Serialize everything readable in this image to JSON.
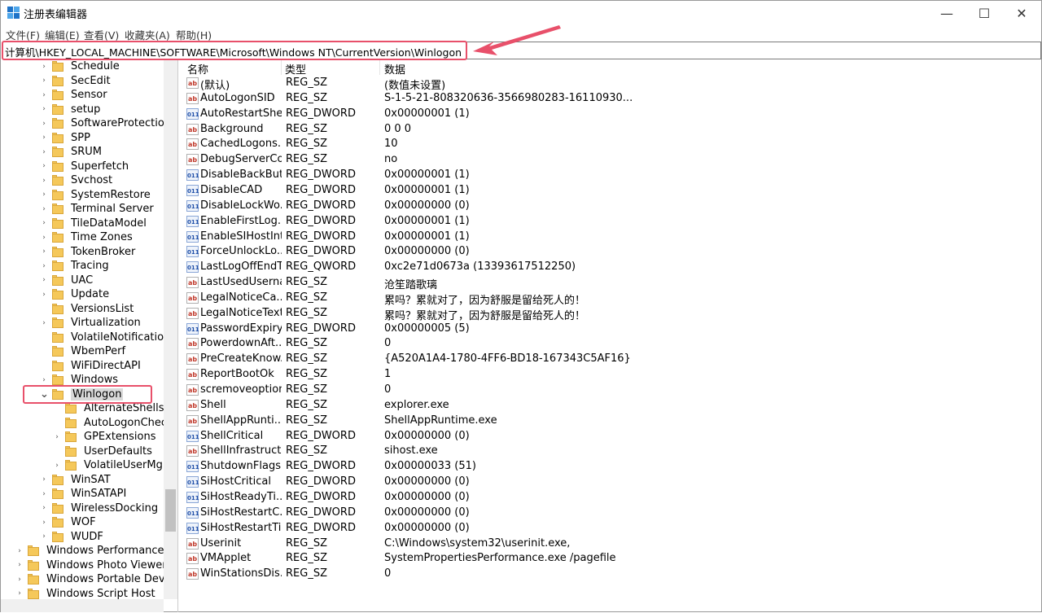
{
  "window": {
    "title": "注册表编辑器",
    "buttons": {
      "minimize": "—",
      "maximize": "☐",
      "close": "✕"
    }
  },
  "menu": [
    "文件(F)",
    "编辑(E)",
    "查看(V)",
    "收藏夹(A)",
    "帮助(H)"
  ],
  "address": "计算机\\HKEY_LOCAL_MACHINE\\SOFTWARE\\Microsoft\\Windows NT\\CurrentVersion\\Winlogon",
  "tree": [
    {
      "label": "Schedule",
      "expander": "›",
      "level": 1
    },
    {
      "label": "SecEdit",
      "expander": "›",
      "level": 1
    },
    {
      "label": "Sensor",
      "expander": "›",
      "level": 1
    },
    {
      "label": "setup",
      "expander": "›",
      "level": 1
    },
    {
      "label": "SoftwareProtectionPl",
      "expander": "›",
      "level": 1
    },
    {
      "label": "SPP",
      "expander": "›",
      "level": 1
    },
    {
      "label": "SRUM",
      "expander": "›",
      "level": 1
    },
    {
      "label": "Superfetch",
      "expander": "›",
      "level": 1
    },
    {
      "label": "Svchost",
      "expander": "›",
      "level": 1
    },
    {
      "label": "SystemRestore",
      "expander": "›",
      "level": 1
    },
    {
      "label": "Terminal Server",
      "expander": "›",
      "level": 1
    },
    {
      "label": "TileDataModel",
      "expander": "›",
      "level": 1
    },
    {
      "label": "Time Zones",
      "expander": "›",
      "level": 1
    },
    {
      "label": "TokenBroker",
      "expander": "›",
      "level": 1
    },
    {
      "label": "Tracing",
      "expander": "›",
      "level": 1
    },
    {
      "label": "UAC",
      "expander": "›",
      "level": 1
    },
    {
      "label": "Update",
      "expander": "›",
      "level": 1
    },
    {
      "label": "VersionsList",
      "expander": "",
      "level": 1
    },
    {
      "label": "Virtualization",
      "expander": "›",
      "level": 1
    },
    {
      "label": "VolatileNotifications",
      "expander": "",
      "level": 1
    },
    {
      "label": "WbemPerf",
      "expander": "",
      "level": 1
    },
    {
      "label": "WiFiDirectAPI",
      "expander": "",
      "level": 1
    },
    {
      "label": "Windows",
      "expander": "›",
      "level": 1
    },
    {
      "label": "Winlogon",
      "expander": "⌄",
      "level": 1,
      "selected": true
    },
    {
      "label": "AlternateShells",
      "expander": "",
      "level": 2
    },
    {
      "label": "AutoLogonChecked",
      "expander": "",
      "level": 2
    },
    {
      "label": "GPExtensions",
      "expander": "›",
      "level": 2
    },
    {
      "label": "UserDefaults",
      "expander": "",
      "level": 2
    },
    {
      "label": "VolatileUserMgrKey",
      "expander": "›",
      "level": 2
    },
    {
      "label": "WinSAT",
      "expander": "›",
      "level": 1
    },
    {
      "label": "WinSATAPI",
      "expander": "›",
      "level": 1
    },
    {
      "label": "WirelessDocking",
      "expander": "›",
      "level": 1
    },
    {
      "label": "WOF",
      "expander": "›",
      "level": 1
    },
    {
      "label": "WUDF",
      "expander": "›",
      "level": 1
    },
    {
      "label": "Windows Performance Toolkit",
      "expander": "›",
      "level": 0
    },
    {
      "label": "Windows Photo Viewer",
      "expander": "›",
      "level": 0
    },
    {
      "label": "Windows Portable Devices",
      "expander": "›",
      "level": 0
    },
    {
      "label": "Windows Script Host",
      "expander": "›",
      "level": 0
    }
  ],
  "list": {
    "headers": {
      "name": "名称",
      "type": "类型",
      "data": "数据"
    },
    "rows": [
      {
        "icon": "ab",
        "name": "(默认)",
        "type": "REG_SZ",
        "data": "(数值未设置)"
      },
      {
        "icon": "ab",
        "name": "AutoLogonSID",
        "type": "REG_SZ",
        "data": "S-1-5-21-808320636-3566980283-16110930..."
      },
      {
        "icon": "bin",
        "name": "AutoRestartShell",
        "type": "REG_DWORD",
        "data": "0x00000001 (1)"
      },
      {
        "icon": "ab",
        "name": "Background",
        "type": "REG_SZ",
        "data": "0 0 0"
      },
      {
        "icon": "ab",
        "name": "CachedLogons...",
        "type": "REG_SZ",
        "data": "10"
      },
      {
        "icon": "ab",
        "name": "DebugServerCo...",
        "type": "REG_SZ",
        "data": "no"
      },
      {
        "icon": "bin",
        "name": "DisableBackBut...",
        "type": "REG_DWORD",
        "data": "0x00000001 (1)"
      },
      {
        "icon": "bin",
        "name": "DisableCAD",
        "type": "REG_DWORD",
        "data": "0x00000001 (1)"
      },
      {
        "icon": "bin",
        "name": "DisableLockWo...",
        "type": "REG_DWORD",
        "data": "0x00000000 (0)"
      },
      {
        "icon": "bin",
        "name": "EnableFirstLog...",
        "type": "REG_DWORD",
        "data": "0x00000001 (1)"
      },
      {
        "icon": "bin",
        "name": "EnableSIHostInt...",
        "type": "REG_DWORD",
        "data": "0x00000001 (1)"
      },
      {
        "icon": "bin",
        "name": "ForceUnlockLo...",
        "type": "REG_DWORD",
        "data": "0x00000000 (0)"
      },
      {
        "icon": "bin",
        "name": "LastLogOffEndT...",
        "type": "REG_QWORD",
        "data": "0xc2e71d0673a (13393617512250)"
      },
      {
        "icon": "ab",
        "name": "LastUsedUserna...",
        "type": "REG_SZ",
        "data": "沧笙踏歌璃"
      },
      {
        "icon": "ab",
        "name": "LegalNoticeCa...",
        "type": "REG_SZ",
        "data": "累吗？累就对了，因为舒服是留给死人的！"
      },
      {
        "icon": "ab",
        "name": "LegalNoticeText",
        "type": "REG_SZ",
        "data": "累吗？累就对了，因为舒服是留给死人的！"
      },
      {
        "icon": "bin",
        "name": "PasswordExpiry...",
        "type": "REG_DWORD",
        "data": "0x00000005 (5)"
      },
      {
        "icon": "ab",
        "name": "PowerdownAft...",
        "type": "REG_SZ",
        "data": "0"
      },
      {
        "icon": "ab",
        "name": "PreCreateKnow...",
        "type": "REG_SZ",
        "data": "{A520A1A4-1780-4FF6-BD18-167343C5AF16}"
      },
      {
        "icon": "ab",
        "name": "ReportBootOk",
        "type": "REG_SZ",
        "data": "1"
      },
      {
        "icon": "ab",
        "name": "scremoveoption",
        "type": "REG_SZ",
        "data": "0"
      },
      {
        "icon": "ab",
        "name": "Shell",
        "type": "REG_SZ",
        "data": "explorer.exe"
      },
      {
        "icon": "ab",
        "name": "ShellAppRunti...",
        "type": "REG_SZ",
        "data": "ShellAppRuntime.exe"
      },
      {
        "icon": "bin",
        "name": "ShellCritical",
        "type": "REG_DWORD",
        "data": "0x00000000 (0)"
      },
      {
        "icon": "ab",
        "name": "ShellInfrastruct...",
        "type": "REG_SZ",
        "data": "sihost.exe"
      },
      {
        "icon": "bin",
        "name": "ShutdownFlags",
        "type": "REG_DWORD",
        "data": "0x00000033 (51)"
      },
      {
        "icon": "bin",
        "name": "SiHostCritical",
        "type": "REG_DWORD",
        "data": "0x00000000 (0)"
      },
      {
        "icon": "bin",
        "name": "SiHostReadyTi...",
        "type": "REG_DWORD",
        "data": "0x00000000 (0)"
      },
      {
        "icon": "bin",
        "name": "SiHostRestartC...",
        "type": "REG_DWORD",
        "data": "0x00000000 (0)"
      },
      {
        "icon": "bin",
        "name": "SiHostRestartTi...",
        "type": "REG_DWORD",
        "data": "0x00000000 (0)"
      },
      {
        "icon": "ab",
        "name": "Userinit",
        "type": "REG_SZ",
        "data": "C:\\Windows\\system32\\userinit.exe,"
      },
      {
        "icon": "ab",
        "name": "VMApplet",
        "type": "REG_SZ",
        "data": "SystemPropertiesPerformance.exe /pagefile"
      },
      {
        "icon": "ab",
        "name": "WinStationsDis...",
        "type": "REG_SZ",
        "data": "0"
      }
    ]
  },
  "colors": {
    "annotation": "#e8506a",
    "folder": "#f5c85a"
  }
}
